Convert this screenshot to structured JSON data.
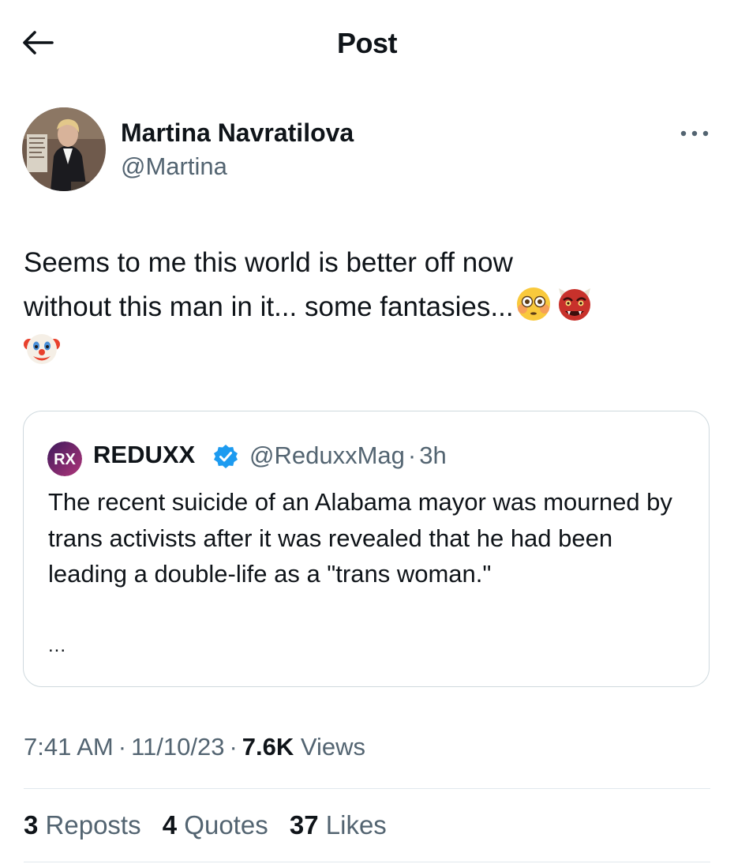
{
  "header": {
    "title": "Post",
    "back_icon": "arrow-left-icon"
  },
  "tweet": {
    "author_name": "Martina Navratilova",
    "author_handle": "@Martina",
    "more_icon": "ellipsis-icon",
    "text_line1": "Seems to me this world is better off now",
    "text_line2": "without this man in it... some fantasies...",
    "emojis": [
      "flushed-face-emoji",
      "ogre-emoji",
      "clown-face-emoji"
    ],
    "time": "7:41 AM",
    "date": "11/10/23",
    "views_count": "7.6K",
    "views_label": "Views",
    "separator": "·"
  },
  "quote": {
    "logo_text": "RX",
    "name": "REDUXX",
    "verified_icon": "verified-badge-icon",
    "handle": "@ReduxxMag",
    "separator": "·",
    "time": "3h",
    "text": "The recent suicide of an Alabama mayor was mourned by trans activists after it was revealed that he had been leading a double-life as a \"trans woman.\"",
    "more": "..."
  },
  "stats": {
    "reposts_count": "3",
    "reposts_label": "Reposts",
    "quotes_count": "4",
    "quotes_label": "Quotes",
    "likes_count": "37",
    "likes_label": "Likes"
  },
  "colors": {
    "text_primary": "#0f1419",
    "text_secondary": "#536471",
    "border": "#cfd9de",
    "verified_blue": "#1d9bf0",
    "reduxx_purple": "#5b2a86"
  }
}
